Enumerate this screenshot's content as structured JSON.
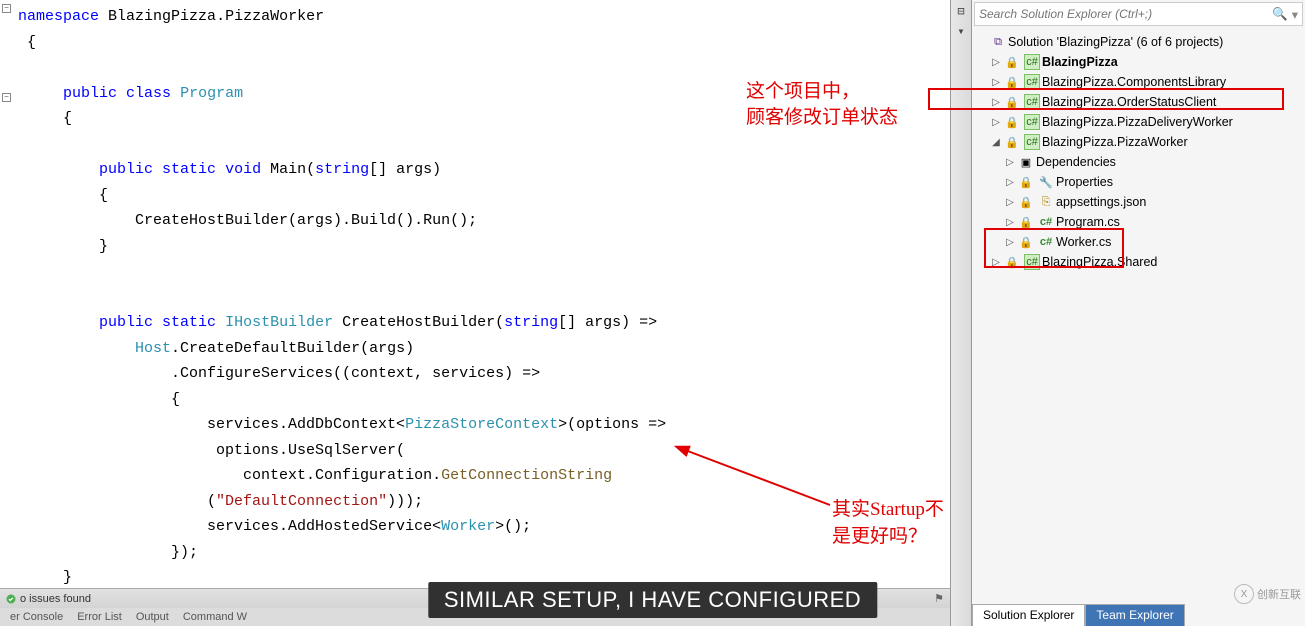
{
  "editor": {
    "code_html": "<span class='kw'>namespace</span> <span class='ident'>BlazingPizza</span>.<span class='ident'>PizzaWorker</span>\n {\n\n     <span class='kw'>public</span> <span class='kw'>class</span> <span class='type'>Program</span>\n     {\n\n         <span class='kw'>public</span> <span class='kw'>static</span> <span class='kw'>void</span> <span class='ident'>Main</span>(<span class='kw'>string</span>[] args)\n         {\n             CreateHostBuilder(args).Build().Run();\n         }\n\n\n         <span class='kw'>public</span> <span class='kw'>static</span> <span class='type'>IHostBuilder</span> CreateHostBuilder(<span class='kw'>string</span>[] args) =&gt;\n             <span class='type'>Host</span>.CreateDefaultBuilder(args)\n                 .ConfigureServices((context, services) =&gt;\n                 {\n                     services.AddDbContext&lt;<span class='type'>PizzaStoreContext</span>&gt;(options =&gt;\n                      options.UseSqlServer(\n                         context.Configuration.<span class='method2'>GetConnectionString</span>\n                     (<span class='str'>\"DefaultConnection\"</span>)));\n                     services.AddHostedService&lt;<span class='type'>Worker</span>&gt;();\n                 });\n     }"
  },
  "annotations": {
    "note1_line1": "这个项目中，",
    "note1_line2": "顾客修改订单状态",
    "note2": "其实Startup不是更好吗？"
  },
  "caption": "SIMILAR SETUP, I HAVE CONFIGURED",
  "status_bar": {
    "issues": "o issues found"
  },
  "bottom_tabs": [
    "er Console",
    "Error List",
    "Output",
    "Command W"
  ],
  "solution_explorer": {
    "search_placeholder": "Search Solution Explorer (Ctrl+;)",
    "solution_label": "Solution 'BlazingPizza' (6 of 6 projects)",
    "projects": {
      "p0": "BlazingPizza",
      "p1": "BlazingPizza.ComponentsLibrary",
      "p2": "BlazingPizza.OrderStatusClient",
      "p3": "BlazingPizza.PizzaDeliveryWorker",
      "p4": "BlazingPizza.PizzaWorker",
      "p5": "BlazingPizza.Shared"
    },
    "pw_children": {
      "c0": "Dependencies",
      "c1": "Properties",
      "c2": "appsettings.json",
      "c3": "Program.cs",
      "c4": "Worker.cs"
    },
    "tabs": {
      "t0": "Solution Explorer",
      "t1": "Team Explorer"
    }
  },
  "watermark": "创新互联"
}
